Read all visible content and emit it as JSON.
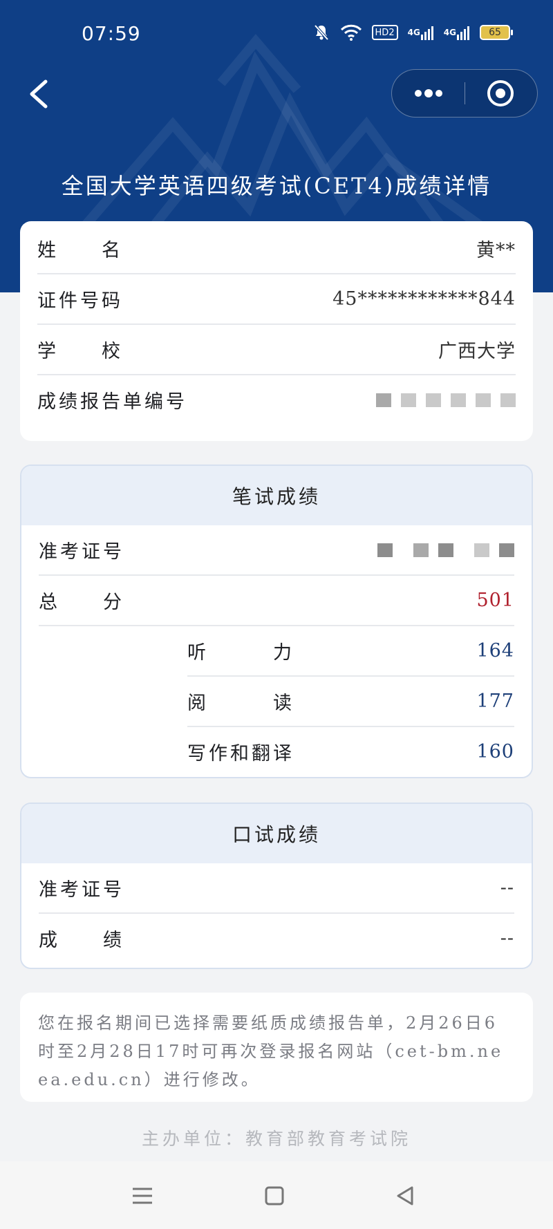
{
  "status_bar": {
    "time": "07:59",
    "hd_label": "HD2",
    "signal_1": "4G",
    "signal_2": "4G",
    "battery": "65",
    "icons": [
      "mute-bell-icon",
      "wifi-icon",
      "hd-icon",
      "signal-icon",
      "signal-icon",
      "battery-icon"
    ]
  },
  "nav": {
    "back_icon": "chevron-left-icon",
    "more_icon": "more-dots-icon",
    "close_icon": "target-icon"
  },
  "page": {
    "title": "全国大学英语四级考试(CET4)成绩详情"
  },
  "info_card": {
    "rows": [
      {
        "label": "姓　　名",
        "value": "黄**"
      },
      {
        "label": "证件号码",
        "value": "45************844"
      },
      {
        "label": "学　　校",
        "value": "广西大学"
      },
      {
        "label": "成绩报告单编号",
        "value": ""
      }
    ]
  },
  "written_card": {
    "title": "笔试成绩",
    "admission_label": "准考证号",
    "admission_value": "",
    "total_label": "总　　分",
    "total_value": "501",
    "sub_rows": [
      {
        "label": "听　　　力",
        "value": "164"
      },
      {
        "label": "阅　　　读",
        "value": "177"
      },
      {
        "label": "写作和翻译",
        "value": "160"
      }
    ]
  },
  "oral_card": {
    "title": "口试成绩",
    "rows": [
      {
        "label": "准考证号",
        "value": "--"
      },
      {
        "label": "成　　绩",
        "value": "--"
      }
    ]
  },
  "notice": {
    "text": "您在报名期间已选择需要纸质成绩报告单，2月26日6时至2月28日17时可再次登录报名网站（cet-bm.neea.edu.cn）进行修改。"
  },
  "footer": {
    "text": "主办单位：教育部教育考试院"
  },
  "system_nav": {
    "icons": [
      "menu-icon",
      "home-square-icon",
      "back-triangle-icon"
    ]
  },
  "colors": {
    "header_bg": "#0f3f86",
    "total_score": "#b0212e",
    "sub_score": "#1d3f78"
  }
}
